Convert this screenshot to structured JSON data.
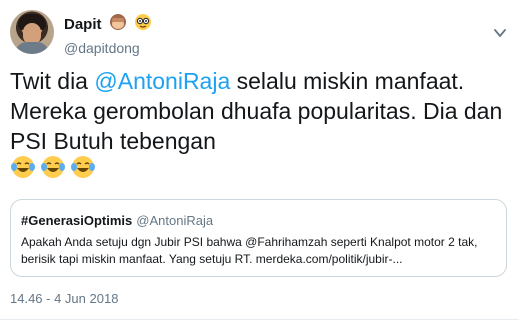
{
  "author": {
    "display_name": "Dapit",
    "handle": "@dapitdong",
    "name_emojis": [
      "see-no-evil-monkey",
      "nerd-face"
    ]
  },
  "tweet": {
    "text_part1": "Twit dia ",
    "mention": "@AntoniRaja",
    "text_part2": " selalu miskin manfaat. Mereka gerombolan dhuafa popularitas. Dia dan PSI Butuh tebengan",
    "emojis": [
      "face-with-tears-of-joy",
      "face-with-tears-of-joy",
      "face-with-tears-of-joy"
    ]
  },
  "quote": {
    "name": "#GenerasiOptimis",
    "handle": "@AntoniRaja",
    "body": "Apakah Anda setuju dgn Jubir PSI bahwa @Fahrihamzah seperti Knalpot motor 2 tak, berisik tapi miskin manfaat. Yang setuju RT.  merdeka.com/politik/jubir-..."
  },
  "timestamp": "14.46 - 4 Jun 2018",
  "colors": {
    "link": "#1da1f2",
    "secondary_text": "#657786",
    "border": "#ccd6dd"
  }
}
